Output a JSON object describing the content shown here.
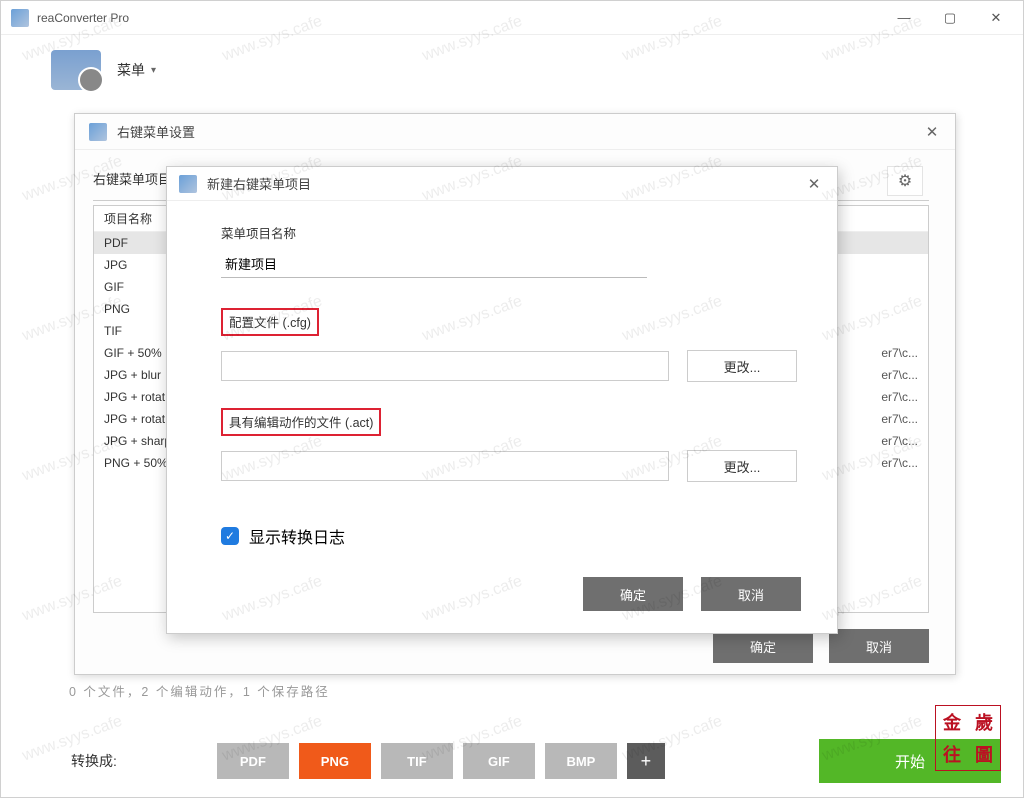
{
  "app": {
    "title": "reaConverter Pro"
  },
  "menubar": {
    "label": "菜单"
  },
  "settings_dialog": {
    "title": "右键菜单设置",
    "list_label": "右键菜单项目",
    "header_name": "项目名称",
    "items": [
      {
        "name": "PDF",
        "path": ""
      },
      {
        "name": "JPG",
        "path": ""
      },
      {
        "name": "GIF",
        "path": ""
      },
      {
        "name": "PNG",
        "path": ""
      },
      {
        "name": "TIF",
        "path": ""
      },
      {
        "name": "GIF + 50% ",
        "path": "er7\\c..."
      },
      {
        "name": "JPG + blur",
        "path": "er7\\c..."
      },
      {
        "name": "JPG + rotat",
        "path": "er7\\c..."
      },
      {
        "name": "JPG + rotat",
        "path": "er7\\c..."
      },
      {
        "name": "JPG + sharp",
        "path": "er7\\c..."
      },
      {
        "name": "PNG + 50%",
        "path": "er7\\c..."
      }
    ],
    "ok": "确定",
    "cancel": "取消"
  },
  "new_dialog": {
    "title": "新建右键菜单项目",
    "name_label": "菜单项目名称",
    "name_value": "新建项目",
    "cfg_label": "配置文件 (.cfg)",
    "act_label": "具有编辑动作的文件 (.act)",
    "change": "更改...",
    "show_log": "显示转换日志",
    "ok": "确定",
    "cancel": "取消"
  },
  "status": "0 个文件，2 个编辑动作，1 个保存路径",
  "bottom": {
    "label": "转换成:",
    "formats": [
      "PDF",
      "PNG",
      "TIF",
      "GIF",
      "BMP"
    ],
    "active_format": "PNG",
    "start": "开始"
  },
  "watermark": "www.syys.cafe",
  "seal": [
    "金",
    "歲",
    "往",
    "圖"
  ]
}
